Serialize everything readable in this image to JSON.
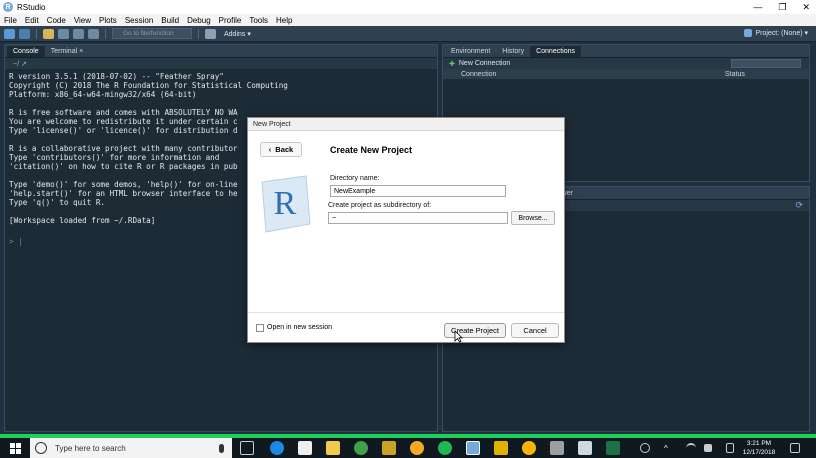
{
  "window": {
    "title": "RStudio",
    "controls": [
      "—",
      "❐",
      "✕"
    ]
  },
  "menu": [
    "File",
    "Edit",
    "Code",
    "View",
    "Plots",
    "Session",
    "Build",
    "Debug",
    "Profile",
    "Tools",
    "Help"
  ],
  "toolbar": {
    "goto_placeholder": "Go to file/function",
    "addins": "Addins ▾",
    "project": "Project: (None) ▾"
  },
  "console": {
    "tabs": [
      "Console",
      "Terminal ×"
    ],
    "path": "~/ ↗",
    "lines": [
      "R version 3.5.1 (2018-07-02) -- \"Feather Spray\"",
      "Copyright (C) 2018 The R Foundation for Statistical Computing",
      "Platform: x86_64-w64-mingw32/x64 (64-bit)",
      "",
      "R is free software and comes with ABSOLUTELY NO WA",
      "You are welcome to redistribute it under certain c",
      "Type 'license()' or 'licence()' for distribution d",
      "",
      "R is a collaborative project with many contributor",
      "Type 'contributors()' for more information and",
      "'citation()' on how to cite R or R packages in pub",
      "",
      "Type 'demo()' for some demos, 'help()' for on-line",
      "'help.start()' for an HTML browser interface to he",
      "Type 'q()' to quit R.",
      "",
      "[Workspace loaded from ~/.RData]",
      ""
    ],
    "prompt": "> |"
  },
  "right_top": {
    "tabs": [
      "Environment",
      "History",
      "Connections"
    ],
    "new_connection": "New Connection",
    "columns": [
      "Connection",
      "Status"
    ]
  },
  "right_bottom": {
    "tab_fragment": "Viewer"
  },
  "dialog": {
    "title": "New Project",
    "back": "Back",
    "heading": "Create New Project",
    "dir_label": "Directory name:",
    "dir_value": "NewExample",
    "subdir_label": "Create project as subdirectory of:",
    "subdir_value": "~",
    "browse": "Browse...",
    "open_new_session": "Open in new session",
    "create": "Create Project",
    "cancel": "Cancel"
  },
  "taskbar": {
    "search_placeholder": "Type here to search",
    "time": "3:21 PM",
    "date": "12/17/2018"
  },
  "colors": {
    "accent": "#75aadb",
    "taskbar_progress": "#1fd05a",
    "pane_bg": "#1d2b36"
  }
}
